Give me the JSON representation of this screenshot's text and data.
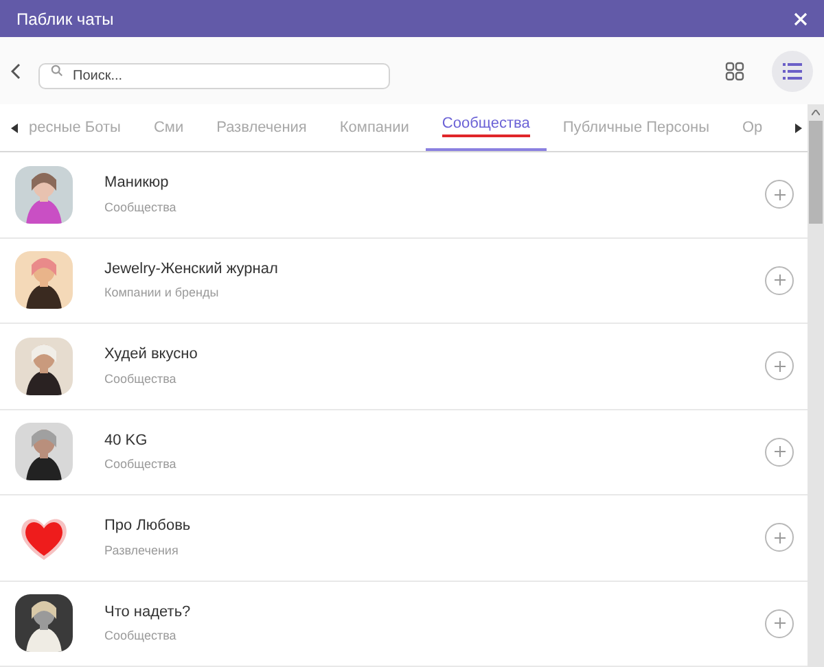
{
  "window": {
    "title": "Паблик чаты"
  },
  "search": {
    "placeholder": "Поиск..."
  },
  "view_modes": [
    {
      "kind": "grid",
      "selected": false
    },
    {
      "kind": "list",
      "selected": true
    }
  ],
  "tabs": [
    {
      "label": "ресные Боты",
      "selected": false
    },
    {
      "label": "Сми",
      "selected": false
    },
    {
      "label": "Развлечения",
      "selected": false
    },
    {
      "label": "Компании",
      "selected": false
    },
    {
      "label": "Сообщества",
      "selected": true
    },
    {
      "label": "Публичные Персоны",
      "selected": false
    },
    {
      "label": "Ор",
      "selected": false
    }
  ],
  "chats": [
    {
      "name": "Маникюр",
      "category": "Сообщества"
    },
    {
      "name": "Jewelry-Женский журнал",
      "category": "Компании и бренды"
    },
    {
      "name": "Худей вкусно",
      "category": "Сообщества"
    },
    {
      "name": "40 KG",
      "category": "Сообщества"
    },
    {
      "name": "Про Любовь",
      "category": "Развлечения",
      "kind": "heart"
    },
    {
      "name": "Что надеть?",
      "category": "Сообщества"
    }
  ]
}
